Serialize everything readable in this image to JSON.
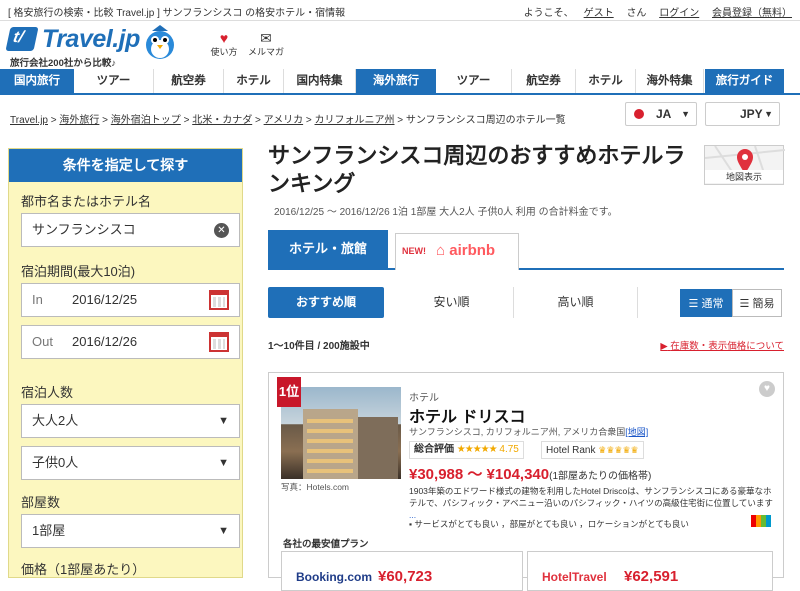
{
  "topbar": {
    "tagline": "[ 格安旅行の検索・比較 Travel.jp ] サンフランシスコ の格安ホテル・宿情報",
    "welcome": "ようこそ、",
    "guest": "ゲスト",
    "san": "さん",
    "login": "ログイン",
    "register": "会員登録（無料）"
  },
  "header": {
    "logo": "Travel.jp",
    "logo_sub": "旅行会社200社から比較♪",
    "howto": "使い方",
    "mailmag": "メルマガ"
  },
  "nav": [
    {
      "label": "国内旅行"
    },
    {
      "label": "ツアー"
    },
    {
      "label": "航空券"
    },
    {
      "label": "ホテル"
    },
    {
      "label": "国内特集"
    },
    {
      "label": "海外旅行"
    },
    {
      "label": "ツアー"
    },
    {
      "label": "航空券"
    },
    {
      "label": "ホテル"
    },
    {
      "label": "海外特集"
    },
    {
      "label": "旅行ガイド"
    }
  ],
  "breadcrumbs": [
    "Travel.jp",
    "海外旅行",
    "海外宿泊トップ",
    "北米・カナダ",
    "アメリカ",
    "カリフォルニア州",
    "サンフランシスコ周辺のホテル一覧"
  ],
  "locale": {
    "lang": "JA",
    "currency": "JPY"
  },
  "sidebar": {
    "heading": "条件を指定して探す",
    "city_label": "都市名またはホテル名",
    "city_value": "サンフランシスコ",
    "stay_label": "宿泊期間(最大10泊)",
    "in_label": "In",
    "in_date": "2016/12/25",
    "out_label": "Out",
    "out_date": "2016/12/26",
    "guests_label": "宿泊人数",
    "adults": "大人2人",
    "children": "子供0人",
    "rooms_label": "部屋数",
    "rooms": "1部屋",
    "price_label": "価格（1部屋あたり）"
  },
  "main": {
    "title": "サンフランシスコ周辺のおすすめホテルランキング",
    "map_label": "地図表示",
    "dates": "2016/12/25 〜 2016/12/26 1泊 1部屋 大人2人 子供0人 利用 の合計料金です。",
    "tab_hotels": "ホテル・旅館",
    "tab_new": "NEW!",
    "tab_airbnb": "airbnb",
    "sort_recommended": "おすすめ順",
    "sort_cheap": "安い順",
    "sort_expensive": "高い順",
    "view_normal": "通常",
    "view_simple": "簡易",
    "count": "1〜10件目 / 200施設中",
    "stock_note": "在庫数・表示価格について"
  },
  "hotel": {
    "rank": "1位",
    "photo_credit": "写真：Hotels.com",
    "category": "ホテル",
    "name": "ホテル ドリスコ",
    "address": "サンフランシスコ, カリフォルニア州, アメリカ合衆国",
    "map_link": "[地図]",
    "rating_label": "総合評価",
    "rating_stars": "★★★★★",
    "rating_value": "4.75",
    "hotel_rank_label": "Hotel Rank",
    "crowns": "♛♛♛♛♛",
    "price_range": "¥30,988 〜 ¥104,340",
    "price_note": "(1部屋あたりの価格帯)",
    "description": "1903年築のエドワード様式の建物を利用したHotel Driscoは、サンフランシスコにある豪華なホテルで、パシフィック・アベニュー沿いのパシフィック・ハイツの高級住宅街に位置しています",
    "more": "...",
    "tags": "サービスがとても良い ，部屋がとても良い ，ロケーションがとても良い",
    "plans_heading": "各社の最安値プラン",
    "plans": [
      {
        "brand": "Booking.com",
        "price": "¥60,723"
      },
      {
        "brand": "HotelTravel",
        "price": "¥62,591"
      }
    ]
  }
}
